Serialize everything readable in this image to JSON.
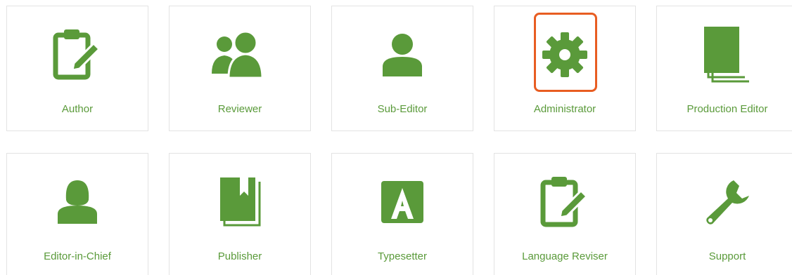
{
  "accent_color": "#5a9a3a",
  "highlight_color": "#e85d22",
  "roles": [
    {
      "label": "Author",
      "icon": "clipboard-edit-icon"
    },
    {
      "label": "Reviewer",
      "icon": "users-icon"
    },
    {
      "label": "Sub-Editor",
      "icon": "user-icon"
    },
    {
      "label": "Administrator",
      "icon": "gear-icon",
      "selected": true
    },
    {
      "label": "Production Editor",
      "icon": "documents-stack-icon"
    },
    {
      "label": "Editor-in-Chief",
      "icon": "user-female-icon"
    },
    {
      "label": "Publisher",
      "icon": "book-icon"
    },
    {
      "label": "Typesetter",
      "icon": "font-icon"
    },
    {
      "label": "Language Reviser",
      "icon": "clipboard-edit-icon"
    },
    {
      "label": "Support",
      "icon": "wrench-icon"
    }
  ]
}
